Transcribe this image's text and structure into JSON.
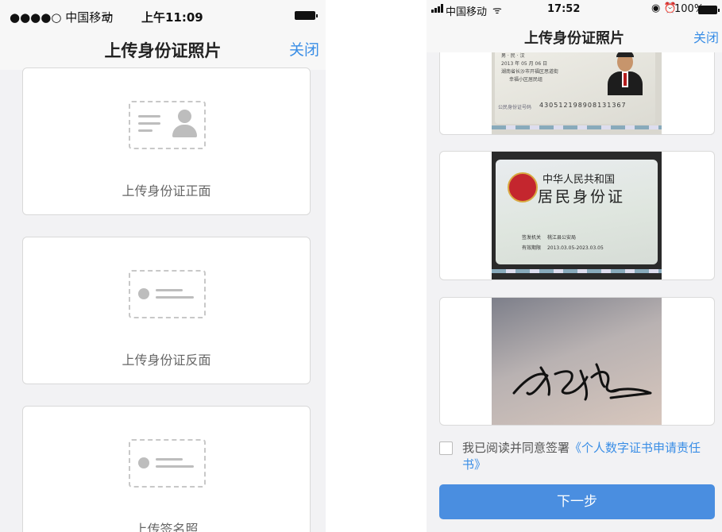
{
  "left": {
    "status": {
      "carrier": "●●●●○ 中国移动",
      "wifi": "ᯤ",
      "time": "上午11:09"
    },
    "nav": {
      "title": "上传身份证照片",
      "close": "关闭"
    },
    "cards": [
      {
        "label": "上传身份证正面",
        "icon": "id-front-placeholder-icon"
      },
      {
        "label": "上传身份证反面",
        "icon": "id-back-placeholder-icon"
      },
      {
        "label": "上传签名照",
        "icon": "signature-placeholder-icon"
      }
    ]
  },
  "right": {
    "status": {
      "carrier": "中国移动",
      "time": "17:52",
      "battery": "100%"
    },
    "nav": {
      "title": "上传身份证照片",
      "close": "关闭"
    },
    "id_front_photo": {
      "lines": [
        "男 · 民 · 汉",
        "2013 年 05 月 06 日",
        "湖南省长沙市开福区思道街",
        "幸福小区居民组"
      ],
      "number_label": "公民身份证号码",
      "number": "430512198908131367"
    },
    "id_back_photo": {
      "country": "中华人民共和国",
      "card_name": "居民身份证",
      "authority_label": "签发机关",
      "authority": "桃江县公安局",
      "validity_label": "有效期限",
      "validity": "2013.03.05-2023.03.05"
    },
    "signature_photo": {
      "text": "许宝山"
    },
    "agreement": {
      "prefix": "我已阅读并同意签署",
      "link": "《个人数字证书申请责任书》"
    },
    "next_button": "下一步",
    "colors": {
      "accent": "#3a8ee6",
      "button": "#4a8ee0"
    }
  }
}
